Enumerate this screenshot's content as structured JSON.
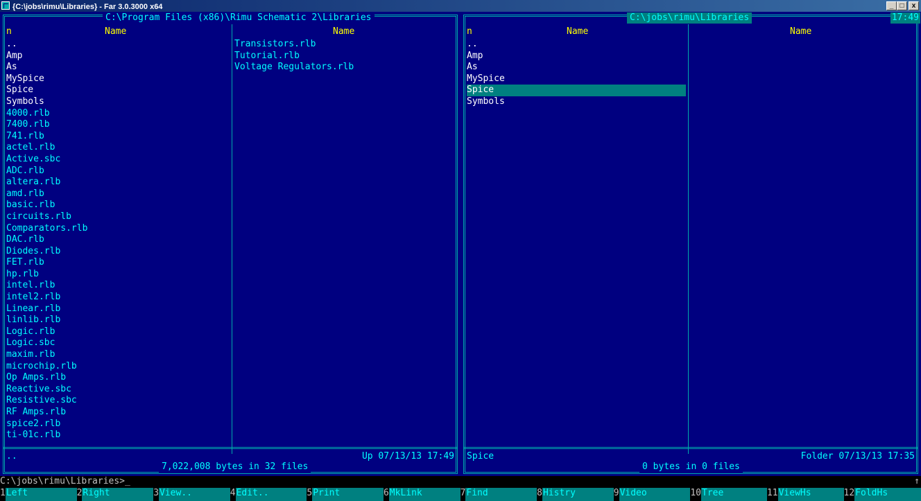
{
  "window": {
    "title": "{C:\\jobs\\rimu\\Libraries} - Far 3.0.3000 x64",
    "buttons": [
      "_",
      "□",
      "x"
    ]
  },
  "left_panel": {
    "path": "C:\\Program Files (x86)\\Rimu Schematic 2\\Libraries",
    "sort_indicator": "n",
    "col_headers": [
      "Name",
      "Name"
    ],
    "col1": [
      "..",
      "Amp",
      "As",
      "MySpice",
      "Spice",
      "Symbols",
      "4000.rlb",
      "7400.rlb",
      "741.rlb",
      "actel.rlb",
      "Active.sbc",
      "ADC.rlb",
      "altera.rlb",
      "amd.rlb",
      "basic.rlb",
      "circuits.rlb",
      "Comparators.rlb",
      "DAC.rlb",
      "Diodes.rlb",
      "FET.rlb",
      "hp.rlb",
      "intel.rlb",
      "intel2.rlb",
      "Linear.rlb",
      "linlib.rlb",
      "Logic.rlb",
      "Logic.sbc",
      "maxim.rlb",
      "microchip.rlb",
      "Op Amps.rlb",
      "Reactive.sbc",
      "Resistive.sbc",
      "RF Amps.rlb",
      "spice2.rlb",
      "ti-01c.rlb"
    ],
    "col1_folders": 6,
    "col2": [
      "Transistors.rlb",
      "Tutorial.rlb",
      "Voltage Regulators.rlb"
    ],
    "status_name": "..",
    "status_info": "Up  07/13/13 17:49",
    "footer": "7,022,008 bytes in 32 files"
  },
  "right_panel": {
    "path": "C:\\jobs\\rimu\\Libraries",
    "clock": "17:49",
    "sort_indicator": "n",
    "col_headers": [
      "Name",
      "Name"
    ],
    "col1": [
      "..",
      "Amp",
      "As",
      "MySpice",
      "Spice",
      "Symbols"
    ],
    "selected_index": 4,
    "status_name": "Spice",
    "status_info": "Folder 07/13/13 17:35",
    "footer": "0 bytes in 0 files"
  },
  "command_line": {
    "prompt": "C:\\jobs\\rimu\\Libraries>_",
    "scroll_indicator": "↑"
  },
  "keybar": [
    {
      "num": "1",
      "label": "Left"
    },
    {
      "num": "2",
      "label": "Right"
    },
    {
      "num": "3",
      "label": "View.."
    },
    {
      "num": "4",
      "label": "Edit.."
    },
    {
      "num": "5",
      "label": "Print"
    },
    {
      "num": "6",
      "label": "MkLink"
    },
    {
      "num": "7",
      "label": "Find"
    },
    {
      "num": "8",
      "label": "Histry"
    },
    {
      "num": "9",
      "label": "Video"
    },
    {
      "num": "10",
      "label": "Tree"
    },
    {
      "num": "11",
      "label": "ViewHs"
    },
    {
      "num": "12",
      "label": "FoldHs"
    }
  ]
}
